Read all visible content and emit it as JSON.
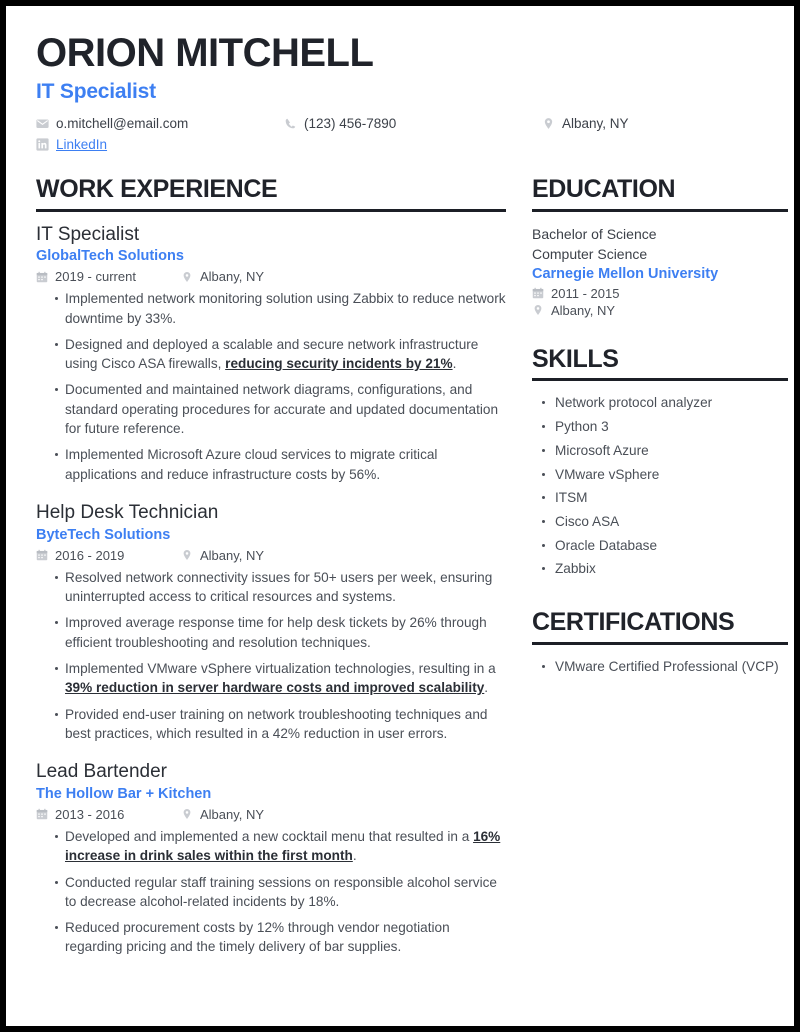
{
  "accent_color": "#3d7ff2",
  "text_color": "#4a4f57",
  "heading_color": "#20232a",
  "header": {
    "name": "ORION MITCHELL",
    "title": "IT Specialist",
    "email": "o.mitchell@email.com",
    "phone": "(123) 456-7890",
    "location": "Albany, NY",
    "linkedin": "LinkedIn",
    "email_icon": "envelope-icon",
    "phone_icon": "phone-icon",
    "location_icon": "map-pin-icon",
    "linkedin_icon": "linkedin-icon"
  },
  "experience": {
    "section_title": "WORK EXPERIENCE",
    "entries": [
      {
        "role": "IT Specialist",
        "company": "GlobalTech Solutions",
        "dates": "2019 - current",
        "location": "Albany, NY",
        "bullets": [
          {
            "text": "Implemented network monitoring solution using Zabbix to reduce network downtime by 33%."
          },
          {
            "pre": "Designed and deployed a scalable and secure network infrastructure using Cisco ASA firewalls, ",
            "highlight": "reducing security incidents by 21%",
            "post": "."
          },
          {
            "text": "Documented and maintained network diagrams, configurations, and standard operating procedures for accurate and updated documentation for future reference."
          },
          {
            "text": "Implemented Microsoft Azure cloud services to migrate critical applications and reduce infrastructure costs by 56%."
          }
        ]
      },
      {
        "role": "Help Desk Technician",
        "company": "ByteTech Solutions",
        "dates": "2016 - 2019",
        "location": "Albany, NY",
        "bullets": [
          {
            "text": "Resolved network connectivity issues for 50+ users per week, ensuring uninterrupted access to critical resources and systems."
          },
          {
            "text": "Improved average response time for help desk tickets by 26% through efficient troubleshooting and resolution techniques."
          },
          {
            "pre": "Implemented VMware vSphere virtualization technologies, resulting in a ",
            "highlight": "39% reduction in server hardware costs and improved scalability",
            "post": "."
          },
          {
            "text": "Provided end-user training on network troubleshooting techniques and best practices, which resulted in a 42% reduction in user errors."
          }
        ]
      },
      {
        "role": "Lead Bartender",
        "company": "The Hollow Bar + Kitchen",
        "dates": "2013 - 2016",
        "location": "Albany, NY",
        "bullets": [
          {
            "pre": "Developed and implemented a new cocktail menu that resulted in a ",
            "highlight": "16% increase in drink sales within the first month",
            "post": "."
          },
          {
            "text": "Conducted regular staff training sessions on responsible alcohol service to decrease alcohol-related incidents by 18%."
          },
          {
            "text": "Reduced procurement costs by 12% through vendor negotiation regarding pricing and the timely delivery of bar supplies."
          }
        ]
      }
    ]
  },
  "education": {
    "section_title": "EDUCATION",
    "degree": "Bachelor of Science",
    "field": "Computer Science",
    "school": "Carnegie Mellon University",
    "dates": "2011 - 2015",
    "location": "Albany, NY"
  },
  "skills": {
    "section_title": "SKILLS",
    "items": [
      "Network protocol analyzer",
      "Python 3",
      "Microsoft Azure",
      "VMware vSphere",
      "ITSM",
      "Cisco ASA",
      "Oracle Database",
      "Zabbix"
    ]
  },
  "certifications": {
    "section_title": "CERTIFICATIONS",
    "items": [
      "VMware Certified Professional (VCP)"
    ]
  }
}
